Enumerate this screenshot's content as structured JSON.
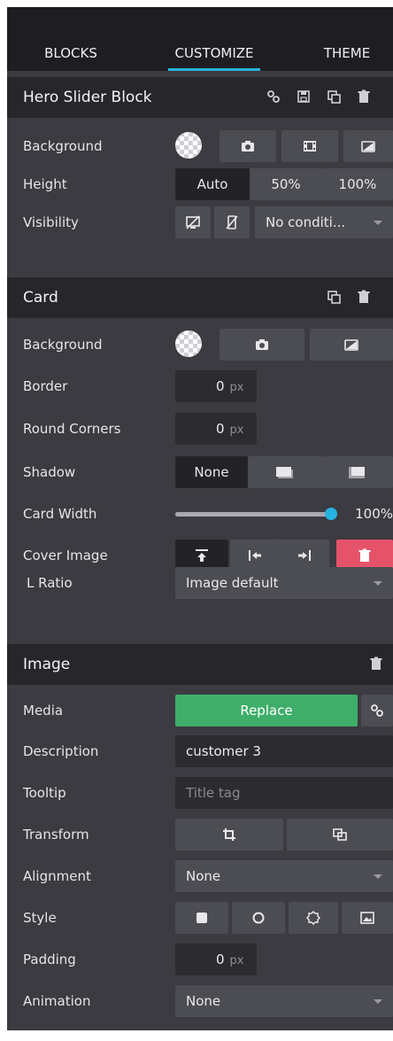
{
  "tabs": [
    {
      "label": "BLOCKS"
    },
    {
      "label": "CUSTOMIZE",
      "active": true
    },
    {
      "label": "THEME"
    }
  ],
  "colors": {
    "accent": "#27b3e0",
    "replace": "#3fae6a",
    "danger": "#e5536a"
  },
  "hero": {
    "title": "Hero Slider Block",
    "background_label": "Background",
    "height_label": "Height",
    "height_options": [
      "Auto",
      "50%",
      "100%"
    ],
    "height_selected": "Auto",
    "visibility_label": "Visibility",
    "visibility_value": "No conditi..."
  },
  "card": {
    "title": "Card",
    "background_label": "Background",
    "border_label": "Border",
    "border_value": "0",
    "round_label": "Round Corners",
    "round_value": "0",
    "unit": "px",
    "shadow_label": "Shadow",
    "shadow_option_none": "None",
    "width_label": "Card Width",
    "width_value": "100%",
    "width_fraction": 1.0,
    "cover_label": "Cover Image",
    "ratio_label": "L Ratio",
    "ratio_value": "Image default"
  },
  "image": {
    "title": "Image",
    "media_label": "Media",
    "replace_label": "Replace",
    "description_label": "Description",
    "description_value": "customer 3",
    "tooltip_label": "Tooltip",
    "tooltip_placeholder": "Title tag",
    "transform_label": "Transform",
    "alignment_label": "Alignment",
    "alignment_value": "None",
    "style_label": "Style",
    "padding_label": "Padding",
    "padding_value": "0",
    "unit": "px",
    "animation_label": "Animation",
    "animation_value": "None"
  }
}
